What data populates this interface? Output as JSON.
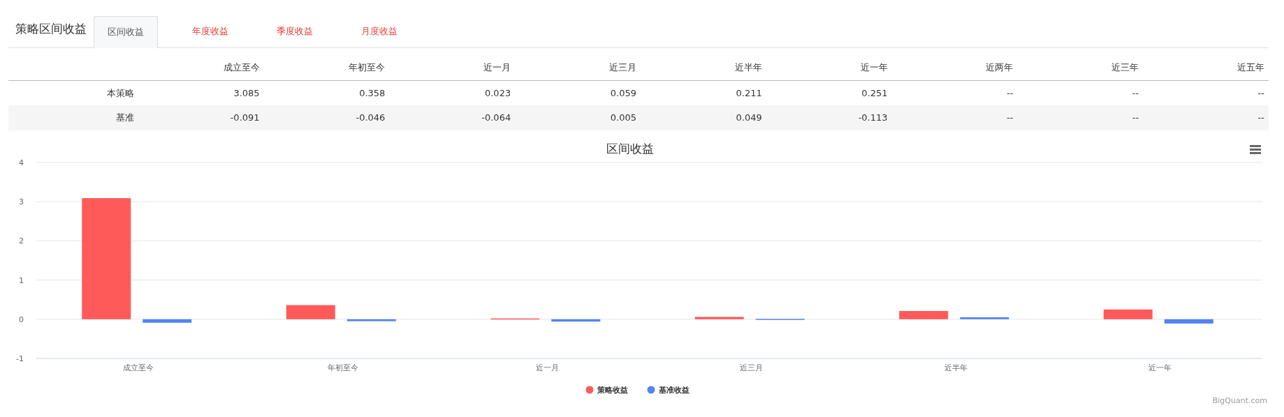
{
  "header": {
    "title": "策略区间收益",
    "tabs": [
      {
        "label": "区间收益",
        "selected": true
      },
      {
        "label": "年度收益",
        "selected": false
      },
      {
        "label": "季度收益",
        "selected": false
      },
      {
        "label": "月度收益",
        "selected": false
      }
    ]
  },
  "table": {
    "columns": [
      "成立至今",
      "年初至今",
      "近一月",
      "近三月",
      "近半年",
      "近一年",
      "近两年",
      "近三年",
      "近五年"
    ],
    "rows": [
      {
        "label": "本策略",
        "values": [
          "3.085",
          "0.358",
          "0.023",
          "0.059",
          "0.211",
          "0.251",
          "--",
          "--",
          "--"
        ]
      },
      {
        "label": "基准",
        "values": [
          "-0.091",
          "-0.046",
          "-0.064",
          "0.005",
          "0.049",
          "-0.113",
          "--",
          "--",
          "--"
        ]
      }
    ]
  },
  "chart": {
    "chart_data": {
      "type": "bar",
      "title": "区间收益",
      "categories": [
        "成立至今",
        "年初至今",
        "近一月",
        "近三月",
        "近半年",
        "近一年"
      ],
      "series": [
        {
          "name": "策略收益",
          "color": "#ff5a5a",
          "values": [
            3.09,
            0.36,
            0.02,
            0.06,
            0.21,
            0.25
          ]
        },
        {
          "name": "基准收益",
          "color": "#5484f3",
          "values": [
            -0.09,
            -0.05,
            -0.06,
            0.01,
            0.05,
            -0.11
          ]
        }
      ],
      "ylim": [
        -1,
        4
      ],
      "yticks": [
        -1,
        0,
        1,
        2,
        3,
        4
      ],
      "grid": true,
      "legend": "bottom"
    },
    "credit": "BigQuant.com"
  }
}
